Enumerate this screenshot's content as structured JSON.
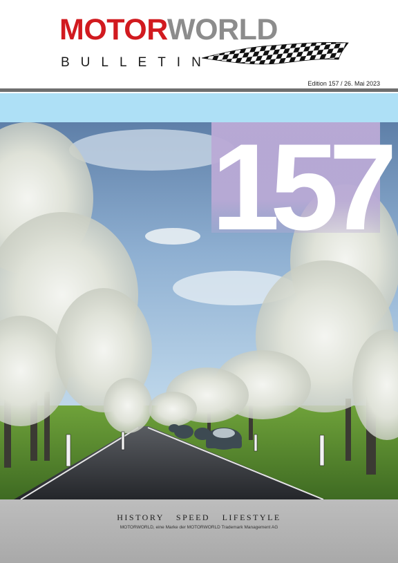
{
  "masthead": {
    "brand_part1": "MOTOR",
    "brand_part2": "WORLD",
    "subtitle": "BULLETIN"
  },
  "edition_line": "Edition 157 / 26. Mai 2023",
  "cover": {
    "issue_number": "157"
  },
  "footer": {
    "tagline": "HISTORY SPEED LIFESTYLE",
    "legal": "MOTORWORLD, eine Marke der MOTORWORLD Trademark Management AG"
  },
  "icons": [
    "checkered-flag-icon"
  ],
  "colors": {
    "brand_red": "#d11a1f",
    "brand_gray": "#8c8c8c",
    "number_box": "#baaad6",
    "sky_bar": "#aee0f6",
    "footer_gray": "#b3b3b3"
  }
}
